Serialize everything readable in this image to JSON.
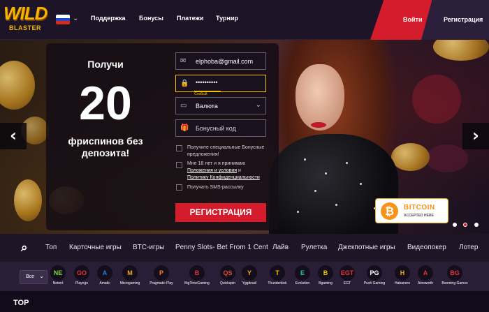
{
  "header": {
    "logo_word1": "WILD",
    "logo_word2": "BLASTER",
    "language": "RU",
    "nav": [
      "Поддержка",
      "Бонусы",
      "Платежи",
      "Турнир"
    ],
    "login_label": "Войти",
    "register_label": "Регистрация"
  },
  "promo": {
    "get_label": "Получи",
    "number": "20",
    "text_line1": "фриспинов без",
    "text_line2": "депозита!"
  },
  "form": {
    "email_value": "elphoba@gmail.com",
    "password_value": "••••••••••",
    "password_strength": "Слабый",
    "currency_label": "Валюта",
    "bonus_code_placeholder": "Бонусный код",
    "checkbox_offers": "Получите специальные Бонусные предложения!",
    "checkbox_terms_prefix": "Мне 18 лет и я принимаю",
    "terms_link": "Положения и условия",
    "terms_and": "и",
    "privacy_link": "Политику Конфиденциальности",
    "checkbox_sms": "Получать SMS-рассылку",
    "submit_label": "РЕГИСТРАЦИЯ"
  },
  "badge": {
    "symbol": "₿",
    "title": "BITCOIN",
    "subtitle": "ACCEPTED HERE"
  },
  "categories": [
    "Топ",
    "Карточные игры",
    "BTC-игры",
    "Penny Slots- Bet From 1 Cent",
    "Лайв",
    "Рулетка",
    "Джекпотные игры",
    "Видеопокер",
    "Лотер"
  ],
  "providers_select": "Все",
  "providers": [
    {
      "label": "Netent",
      "mark": "NE",
      "color": "#7fd23a"
    },
    {
      "label": "Playngo",
      "mark": "GO",
      "color": "#e23434"
    },
    {
      "label": "Amatic",
      "mark": "A",
      "color": "#2f7de1"
    },
    {
      "label": "Microgaming",
      "mark": "M",
      "color": "#f2a81d"
    },
    {
      "label": "Pragmatic Play",
      "mark": "P",
      "color": "#f58220"
    },
    {
      "label": "BigTimeGaming",
      "mark": "B",
      "color": "#e23434"
    },
    {
      "label": "Quickspin",
      "mark": "QS",
      "color": "#d8493a"
    },
    {
      "label": "Yggdrasil",
      "mark": "Y",
      "color": "#f2a81d"
    },
    {
      "label": "Thunderkick",
      "mark": "T",
      "color": "#f2c200"
    },
    {
      "label": "Evolution",
      "mark": "E",
      "color": "#20c2a2"
    },
    {
      "label": "Bgaming",
      "mark": "B",
      "color": "#f2c200"
    },
    {
      "label": "EGT",
      "mark": "EGT",
      "color": "#e23434"
    },
    {
      "label": "Push Gaming",
      "mark": "PG",
      "color": "#ffffff"
    },
    {
      "label": "Habanero",
      "mark": "H",
      "color": "#f2a81d"
    },
    {
      "label": "Ainsworth",
      "mark": "A",
      "color": "#e23434"
    },
    {
      "label": "Booming Games",
      "mark": "BG",
      "color": "#e23434"
    }
  ],
  "section_title": "TOP"
}
